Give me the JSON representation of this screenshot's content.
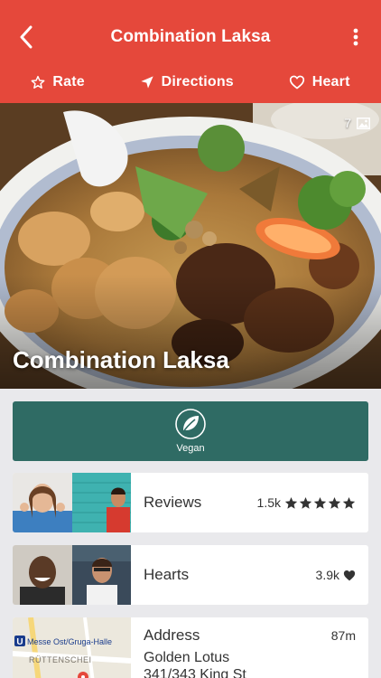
{
  "header": {
    "title": "Combination Laksa",
    "actions": [
      {
        "label": "Rate"
      },
      {
        "label": "Directions"
      },
      {
        "label": "Heart"
      }
    ]
  },
  "hero": {
    "photo_count": "7",
    "title": "Combination Laksa"
  },
  "tag": {
    "label": "Vegan"
  },
  "reviews": {
    "label": "Reviews",
    "count": "1.5k",
    "stars": 5
  },
  "hearts": {
    "label": "Hearts",
    "count": "3.9k"
  },
  "address": {
    "label": "Address",
    "distance": "87m",
    "line1": "Golden Lotus",
    "line2": "341/343 King St",
    "map_labels": [
      "U",
      "Messe Ost/Gruga-Halle",
      "RÜTTENSCHEI"
    ]
  },
  "colors": {
    "header": "#e5483b",
    "vegan": "#2f6b64",
    "background": "#e9e9ec"
  }
}
